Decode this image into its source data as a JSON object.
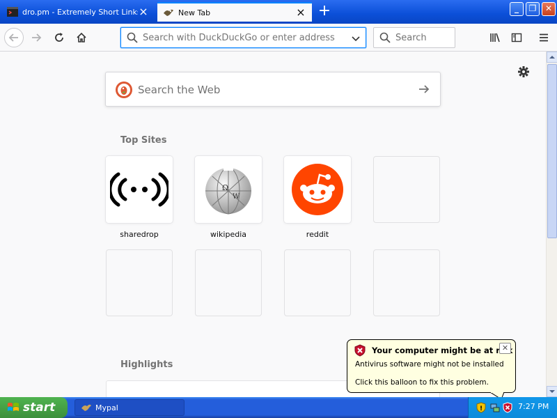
{
  "tabs": [
    {
      "label": "dro.pm - Extremely Short Links",
      "active": false
    },
    {
      "label": "New Tab",
      "active": true
    }
  ],
  "navbar": {
    "url_placeholder": "Search with DuckDuckGo or enter address",
    "search_placeholder": "Search"
  },
  "newtab": {
    "search_placeholder": "Search the Web",
    "top_sites_title": "Top Sites",
    "highlights_title": "Highlights",
    "top_sites": [
      {
        "label": "sharedrop",
        "icon": "sharedrop-icon"
      },
      {
        "label": "wikipedia",
        "icon": "wikipedia-icon"
      },
      {
        "label": "reddit",
        "icon": "reddit-icon"
      }
    ]
  },
  "balloon": {
    "title": "Your computer might be at risk",
    "line1": "Antivirus software might not be installed",
    "line2": "Click this balloon to fix this problem."
  },
  "taskbar": {
    "start_label": "start",
    "task_label": "Mypal",
    "clock": "7:27 PM"
  },
  "colors": {
    "accent": "#0a84ff",
    "reddit": "#ff4500",
    "ddg": "#de5833",
    "taskbar": "#245edb"
  }
}
